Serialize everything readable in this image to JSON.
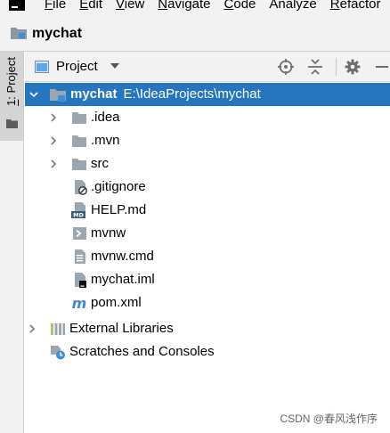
{
  "menu": {
    "items": [
      {
        "label": "File",
        "mnemonic": "F",
        "rest": "ile"
      },
      {
        "label": "Edit",
        "mnemonic": "E",
        "rest": "dit"
      },
      {
        "label": "View",
        "mnemonic": "V",
        "rest": "iew"
      },
      {
        "label": "Navigate",
        "mnemonic": "N",
        "rest": "avigate"
      },
      {
        "label": "Code",
        "mnemonic": "C",
        "rest": "ode"
      },
      {
        "label": "Analyze",
        "mnemonic": "",
        "rest": "Analyze"
      },
      {
        "label": "Refactor",
        "mnemonic": "R",
        "rest": "efactor"
      }
    ]
  },
  "navbar": {
    "project_name": "mychat"
  },
  "toolstrip": {
    "tab_number": "1",
    "tab_rest": ": Project"
  },
  "panel": {
    "title": "Project"
  },
  "tree": {
    "root": {
      "name": "mychat",
      "path": "E:\\IdeaProjects\\mychat"
    },
    "children": [
      {
        "name": ".idea",
        "type": "folder",
        "expandable": true
      },
      {
        "name": ".mvn",
        "type": "folder",
        "expandable": true
      },
      {
        "name": "src",
        "type": "folder",
        "expandable": true
      },
      {
        "name": ".gitignore",
        "type": "ignore-file",
        "expandable": false
      },
      {
        "name": "HELP.md",
        "type": "markdown-file",
        "expandable": false
      },
      {
        "name": "mvnw",
        "type": "script-file",
        "expandable": false
      },
      {
        "name": "mvnw.cmd",
        "type": "text-file",
        "expandable": false
      },
      {
        "name": "mychat.iml",
        "type": "module-file",
        "expandable": false
      },
      {
        "name": "pom.xml",
        "type": "maven-file",
        "expandable": false
      }
    ],
    "external_libraries": "External Libraries",
    "scratches": "Scratches and Consoles"
  },
  "watermark": "CSDN @春风浅作序",
  "colors": {
    "selection": "#2675bf",
    "folder_gray": "#9aa7b0",
    "maven_blue": "#3d8ad9"
  }
}
